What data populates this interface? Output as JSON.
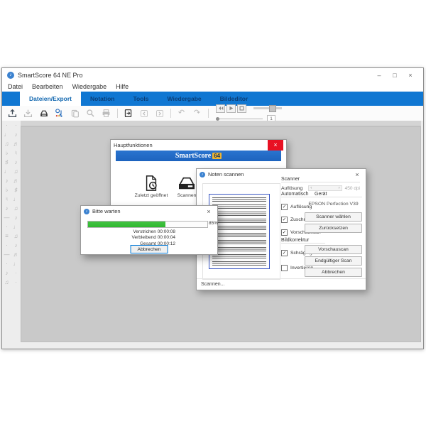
{
  "colors": {
    "ribbon": "#1077d2",
    "banner": "#1d63be",
    "badge_bg": "#efb42e",
    "badge_text": "#17355e",
    "progress_green": "#2eb82e",
    "close_red": "#e81123",
    "focus_blue": "#0078d7"
  },
  "window": {
    "title": "SmartScore 64 NE Pro",
    "minimize": "–",
    "maximize": "□",
    "close": "×"
  },
  "menu": {
    "items": [
      "Datei",
      "Bearbeiten",
      "Wiedergabe",
      "Hilfe"
    ]
  },
  "ribbon": {
    "tabs": [
      "Dateien/Export",
      "Notation",
      "Tools",
      "Wiedergabe",
      "Bildeditor"
    ],
    "active_index": 0
  },
  "toolbar": {
    "page_value": "1",
    "icons": [
      "open-file",
      "save-file",
      "scan",
      "recognition",
      "copy",
      "zoom",
      "print",
      "export-page",
      "previous-page",
      "next-page",
      "undo",
      "redo",
      "rewind",
      "play",
      "stop",
      "volume-slider",
      "position-slider",
      "page-number"
    ]
  },
  "palette": {
    "glyphs": [
      "·",
      "·",
      "♩",
      "♪",
      "♫",
      "♬",
      "♭",
      "♮",
      "♯",
      "♪",
      "♩",
      "♫",
      "♪",
      "♬",
      "♭",
      "♯",
      "♮",
      "♩",
      "♪",
      "♫",
      "—",
      "♪",
      "·",
      "♩",
      "≡",
      "♫",
      "·",
      "♪",
      "—",
      "♬",
      "·",
      "♩",
      "♪",
      "·",
      "♫",
      "·"
    ]
  },
  "haupt_dialog": {
    "title": "Hauptfunktionen",
    "brand": "SmartScore",
    "badge": "64",
    "close": "×",
    "actions": [
      {
        "label": "Zuletzt geöffnet"
      },
      {
        "label": "Scannen"
      }
    ]
  },
  "scan_dialog": {
    "title": "Noten scannen",
    "close": "×",
    "status": "Scannen...",
    "scanner_group": {
      "label": "Scanner",
      "resolution_label": "Auflösung",
      "resolution_value": "450 dpi"
    },
    "auto_group": {
      "label": "Automatisch",
      "checkboxes": [
        {
          "label": "Auflösung",
          "checked": true
        },
        {
          "label": "Zuschneiden",
          "checked": true
        },
        {
          "label": "Vorschauscan",
          "checked": true
        }
      ]
    },
    "device_group": {
      "label": "Gerät",
      "device": "EPSON Perfection V39",
      "select_button": "Scanner wählen",
      "reset_button": "Zurücksetzen"
    },
    "correction_group": {
      "label": "Bildkorrektur",
      "checkboxes": [
        {
          "label": "Schräglage",
          "checked": true
        },
        {
          "label": "Invertieren",
          "checked": false
        }
      ],
      "preview_button": "Vorschauscan",
      "final_button": "Endgültiger Scan",
      "cancel_button": "Abbrechen"
    }
  },
  "progress_dialog": {
    "title": "Bitte warten",
    "close": "×",
    "percent_label": "85%",
    "fill_percent": 65,
    "rows": [
      {
        "label": "Verstrichen",
        "value": "00:00:08"
      },
      {
        "label": "Verbleibend",
        "value": "00:00:04"
      },
      {
        "label": "Gesamt",
        "value": "00:00:12"
      }
    ],
    "cancel_button": "Abbrechen"
  }
}
